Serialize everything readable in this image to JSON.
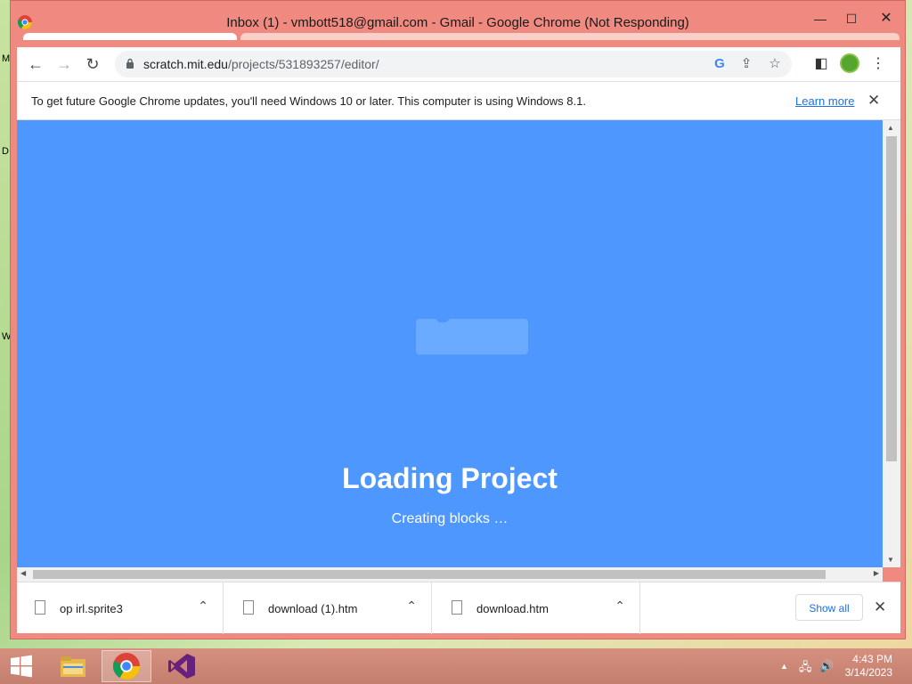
{
  "window": {
    "title": "Inbox (1) - vmbott518@gmail.com - Gmail - Google Chrome (Not Responding)",
    "minimize": "—",
    "maximize": "☐",
    "close": "✕"
  },
  "desktop": {
    "edge_letters": [
      "M",
      "D",
      "W"
    ]
  },
  "toolbar": {
    "back": "←",
    "forward": "→",
    "reload": "↻",
    "url_host": "scratch.mit.edu",
    "url_path": "/projects/531893257/editor/",
    "google_icon": "G",
    "share_icon": "⇪",
    "bookmark_icon": "☆",
    "sidepanel_icon": "◧",
    "menu_icon": "⋮"
  },
  "infobar": {
    "message": "To get future Google Chrome updates, you'll need Windows 10 or later. This computer is using Windows 8.1.",
    "link": "Learn more",
    "close": "✕"
  },
  "content": {
    "title": "Loading Project",
    "subtitle": "Creating blocks …",
    "background": "#4d97ff"
  },
  "downloads": {
    "items": [
      {
        "name": "op irl.sprite3"
      },
      {
        "name": "download (1).htm"
      },
      {
        "name": "download.htm"
      }
    ],
    "caret": "⌃",
    "show_all": "Show all",
    "close": "✕"
  },
  "taskbar": {
    "clock_time": "4:43 PM",
    "clock_date": "3/14/2023"
  }
}
